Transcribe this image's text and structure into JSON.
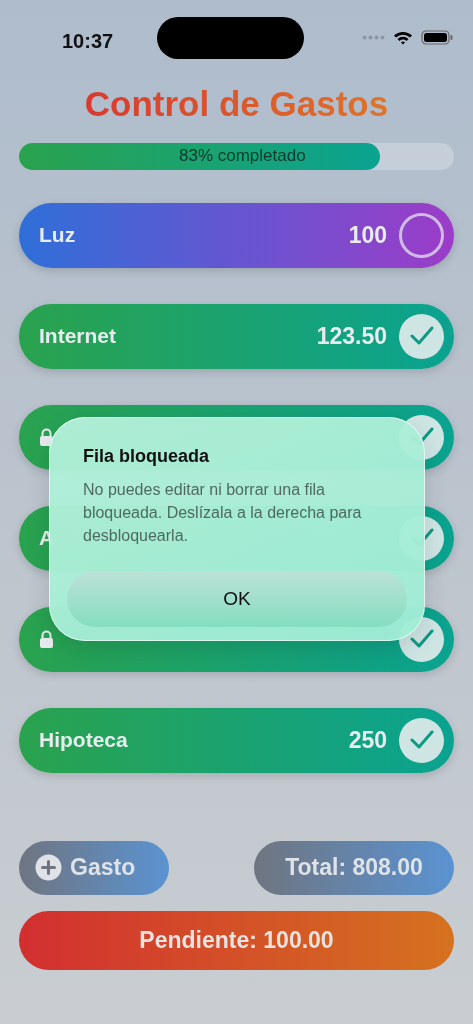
{
  "status_bar": {
    "time": "10:37"
  },
  "title": "Control de Gastos",
  "progress": {
    "level": 0.83,
    "label": "83% completado"
  },
  "rows": [
    {
      "name": "Luz",
      "amount": "100",
      "locked": false,
      "checked": false
    },
    {
      "name": "Internet",
      "amount": "123.50",
      "locked": false,
      "checked": true
    },
    {
      "locked": true,
      "checked": true
    },
    {
      "name": "A",
      "locked": false,
      "checked": true
    },
    {
      "locked": true,
      "checked": true
    },
    {
      "name": "Hipoteca",
      "amount": "250",
      "locked": false,
      "checked": true
    }
  ],
  "add_button": {
    "label": "Gasto"
  },
  "total": "Total: 808.00",
  "pending": "Pendiente: 100.00",
  "alert": {
    "title": "Fila bloqueada",
    "message": "No puedes editar ni borrar una fila bloqueada. Deslízala a la derecha para desbloquearla.",
    "buttons": [
      "OK"
    ]
  }
}
